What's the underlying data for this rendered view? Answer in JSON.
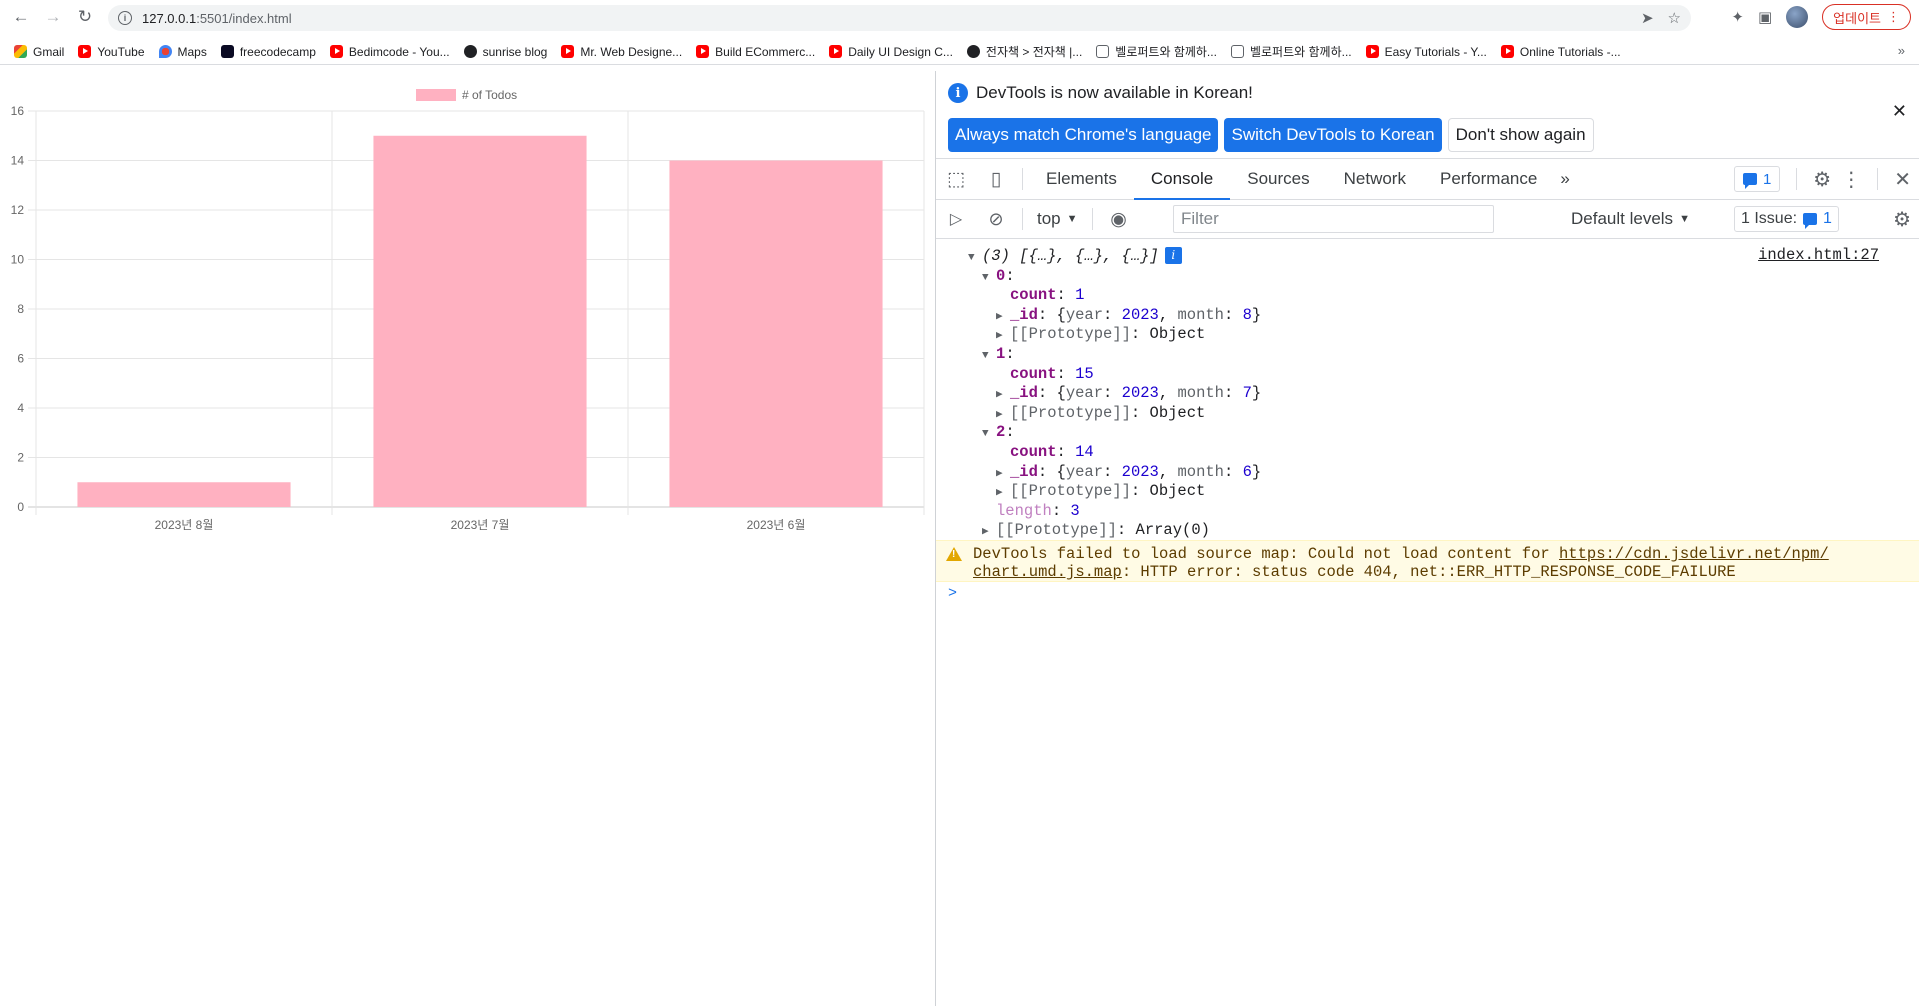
{
  "browser": {
    "url_host": "127.0.0.1",
    "url_rest": ":5501/index.html",
    "update_label": "업데이트",
    "bookmarks": [
      {
        "label": "Gmail",
        "icon": "gm"
      },
      {
        "label": "YouTube",
        "icon": "yt"
      },
      {
        "label": "Maps",
        "icon": "map"
      },
      {
        "label": "freecodecamp",
        "icon": "fcc"
      },
      {
        "label": "Bedimcode - You...",
        "icon": "yt"
      },
      {
        "label": "sunrise blog",
        "icon": "glob"
      },
      {
        "label": "Mr. Web Designe...",
        "icon": "yt"
      },
      {
        "label": "Build ECommerc...",
        "icon": "yt"
      },
      {
        "label": "Daily UI Design C...",
        "icon": "yt"
      },
      {
        "label": "전자책 > 전자책 |...",
        "icon": "glob"
      },
      {
        "label": "벨로퍼트와 함께하...",
        "icon": "book"
      },
      {
        "label": "벨로퍼트와 함께하...",
        "icon": "book"
      },
      {
        "label": "Easy Tutorials - Y...",
        "icon": "yt"
      },
      {
        "label": "Online Tutorials -...",
        "icon": "yt"
      }
    ],
    "bookmarks_more": "»"
  },
  "chart_data": {
    "type": "bar",
    "categories": [
      "2023년 8월",
      "2023년 7월",
      "2023년 6월"
    ],
    "series": [
      {
        "name": "# of Todos",
        "values": [
          1,
          15,
          14
        ],
        "color": "#ffb1c1"
      }
    ],
    "ylim": [
      0,
      16
    ],
    "yticks": [
      0,
      2,
      4,
      6,
      8,
      10,
      12,
      14,
      16
    ],
    "grid": true,
    "legend": "top"
  },
  "devtools": {
    "infobar": {
      "message": "DevTools is now available in Korean!",
      "btn_match": "Always match Chrome's language",
      "btn_switch": "Switch DevTools to Korean",
      "btn_dismiss": "Don't show again"
    },
    "tabs": [
      "Elements",
      "Console",
      "Sources",
      "Network",
      "Performance"
    ],
    "active_tab": "Console",
    "more_tabs": "»",
    "issue_badge": "1",
    "context": "top",
    "filter_placeholder": "Filter",
    "levels": "Default levels",
    "issues_label": "1 Issue:",
    "issues_num": "1",
    "console": {
      "source_link": "index.html:27",
      "array_head": "(3) [{…}, {…}, {…}]",
      "entries": [
        {
          "index": "0",
          "count": "1",
          "year": "2023",
          "month": "8"
        },
        {
          "index": "1",
          "count": "15",
          "year": "2023",
          "month": "7"
        },
        {
          "index": "2",
          "count": "14",
          "year": "2023",
          "month": "6"
        }
      ],
      "length": "3",
      "proto_array": "Array(0)",
      "warning_1": "DevTools failed to load source map: Could not load content for ",
      "warning_link_1": "https://cdn.jsdelivr.net/npm/",
      "warning_link_2": "chart.umd.js.map",
      "warning_2": ": HTTP error: status code 404, net::ERR_HTTP_RESPONSE_CODE_FAILURE",
      "prompt": ">"
    }
  }
}
